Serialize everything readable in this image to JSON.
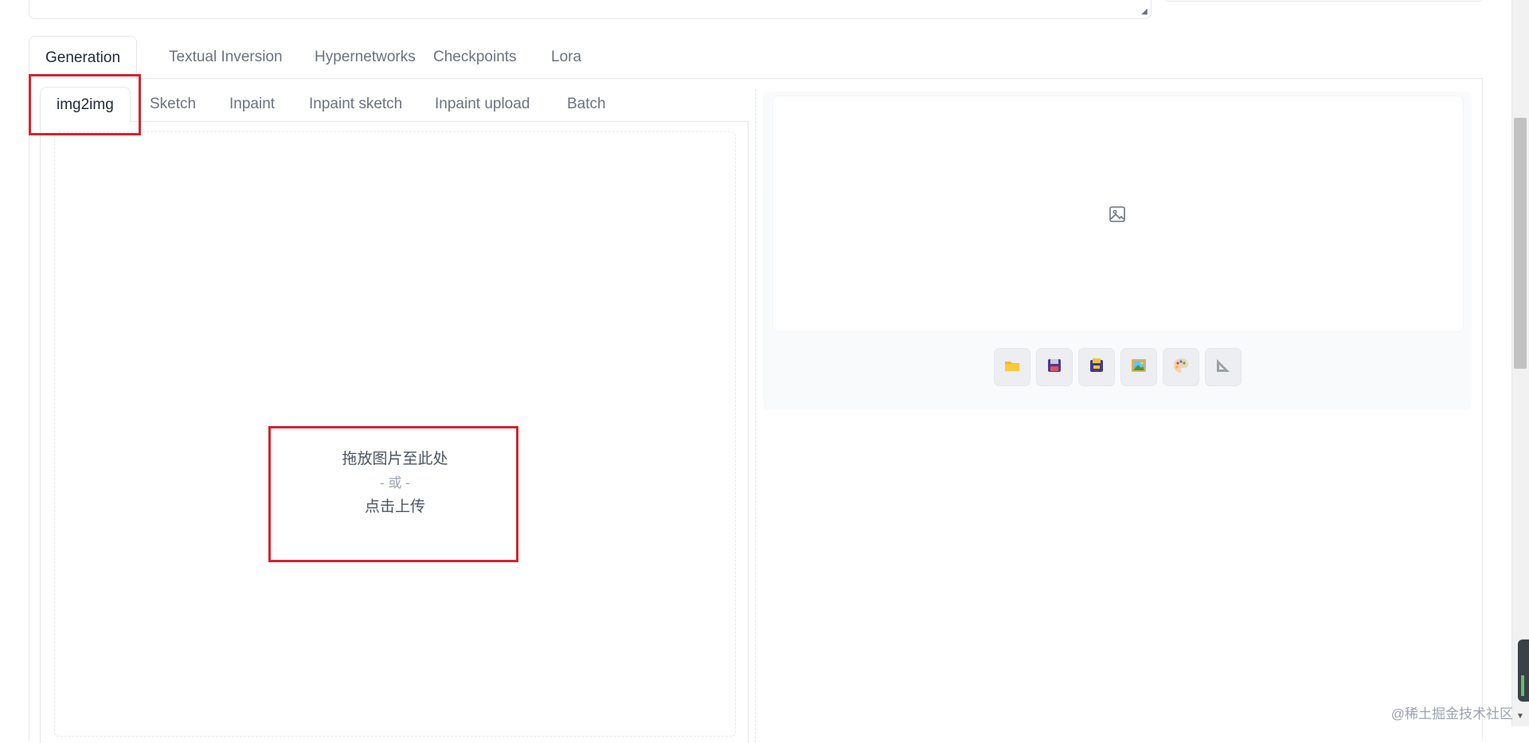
{
  "main_tabs": [
    {
      "label": "Generation",
      "active": true
    },
    {
      "label": "Textual Inversion"
    },
    {
      "label": "Hypernetworks"
    },
    {
      "label": "Checkpoints"
    },
    {
      "label": "Lora"
    }
  ],
  "sub_tabs": [
    {
      "label": "img2img",
      "active": true
    },
    {
      "label": "Sketch"
    },
    {
      "label": "Inpaint"
    },
    {
      "label": "Inpaint sketch"
    },
    {
      "label": "Inpaint upload"
    },
    {
      "label": "Batch"
    }
  ],
  "drop_zone": {
    "line1": "拖放图片至此处",
    "separator": "- 或 -",
    "line2": "点击上传"
  },
  "output_toolbar": [
    {
      "icon": "folder-icon"
    },
    {
      "icon": "save-icon"
    },
    {
      "icon": "zip-icon"
    },
    {
      "icon": "picture-icon"
    },
    {
      "icon": "palette-icon"
    },
    {
      "icon": "ruler-triangle-icon"
    }
  ],
  "watermark": "@稀土掘金技术社区",
  "colors": {
    "highlight": "#d7232d",
    "tab_active_text": "#1f2937",
    "tab_text": "#6b7280",
    "border": "#e5e7eb"
  }
}
